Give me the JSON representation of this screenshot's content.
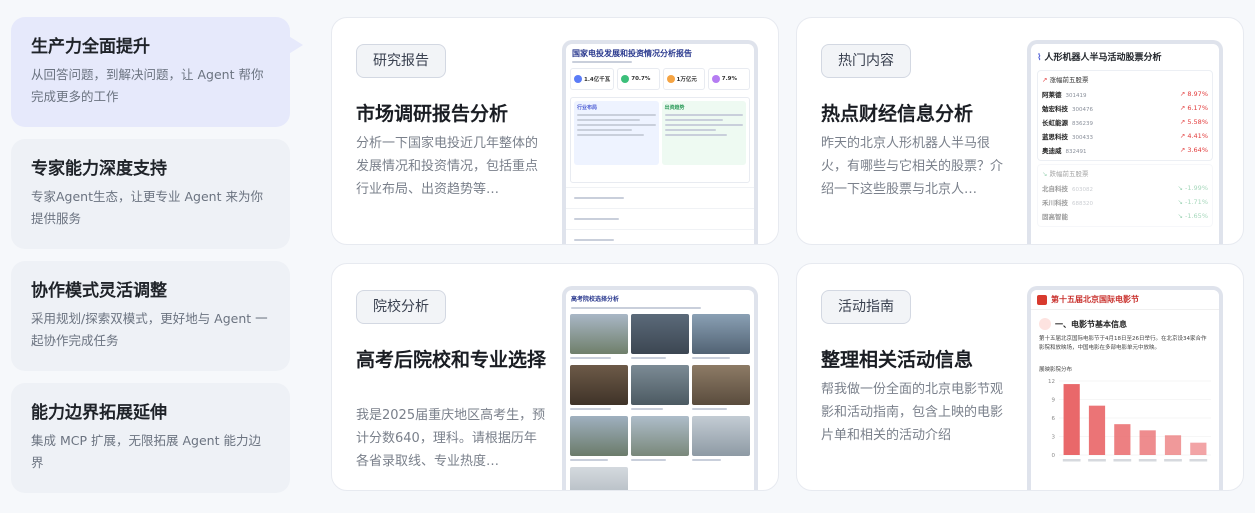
{
  "features": [
    {
      "title": "生产力全面提升",
      "desc": "从回答问题，到解决问题，让 Agent 帮你完成更多的工作"
    },
    {
      "title": "专家能力深度支持",
      "desc": "专家Agent生态，让更专业 Agent 来为你提供服务"
    },
    {
      "title": "协作模式灵活调整",
      "desc": "采用规划/探索双模式，更好地与 Agent 一起协作完成任务"
    },
    {
      "title": "能力边界拓展延伸",
      "desc": "集成 MCP 扩展，无限拓展 Agent 能力边界"
    }
  ],
  "cards": [
    {
      "tag": "研究报告",
      "title": "市场调研报告分析",
      "desc": "分析一下国家电投近几年整体的发展情况和投资情况，包括重点行业布局、出资趋势等…"
    },
    {
      "tag": "热门内容",
      "title": "热点财经信息分析",
      "desc": "昨天的北京人形机器人半马很火，有哪些与它相关的股票？介绍一下这些股票与北京人…"
    },
    {
      "tag": "院校分析",
      "title": "高考后院校和专业选择",
      "desc": "我是2025届重庆地区高考生，预计分数640，理科。请根据历年各省录取线、专业热度…"
    },
    {
      "tag": "活动指南",
      "title": "整理相关活动信息",
      "desc": "帮我做一份全面的北京电影节观影和活动指南，包含上映的电影片单和相关的活动介绍"
    }
  ],
  "preview_report": {
    "title": "国家电投发展和投资情况分析报告",
    "kpis": [
      {
        "value": "1.4亿千瓦",
        "color": "#5b7cf7"
      },
      {
        "value": "70.7%",
        "color": "#3cbf7a"
      },
      {
        "value": "1万亿元",
        "color": "#f5a443"
      },
      {
        "value": "7.9%",
        "color": "#b57cf2"
      }
    ],
    "panel_left": "行业布局",
    "panel_right": "出资趋势"
  },
  "preview_stocks": {
    "title": "人形机器人半马活动股票分析",
    "up_group": "涨幅前五股票",
    "up": [
      {
        "name": "阿莱德",
        "code": "301419",
        "chg": "↗ 8.97%"
      },
      {
        "name": "勉宏科技",
        "code": "300476",
        "chg": "↗ 6.17%"
      },
      {
        "name": "长虹能源",
        "code": "836239",
        "chg": "↗ 5.58%"
      },
      {
        "name": "蓝思科技",
        "code": "300433",
        "chg": "↗ 4.41%"
      },
      {
        "name": "奥迪威",
        "code": "832491",
        "chg": "↗ 3.64%"
      }
    ],
    "down_group": "跌幅前五股票",
    "down": [
      {
        "name": "北自科技",
        "code": "603082",
        "chg": "↘ -1.99%"
      },
      {
        "name": "禾川科技",
        "code": "688320",
        "chg": "↘ -1.71%"
      },
      {
        "name": "固高智能",
        "code": "",
        "chg": "↘ -1.65%"
      }
    ]
  },
  "preview_schools": {
    "title": "高考院校选择分析"
  },
  "preview_festival": {
    "title": "第十五届北京国际电影节",
    "section": "一、电影节基本信息",
    "body": "第十五届北京国际电影节于4月18日至26日举行。在北京设34家合作影院和放映场，中国电影在多部电影单元中放映。",
    "chart_label": "展映影院分布",
    "y_ticks": [
      "12",
      "9",
      "6",
      "3",
      "0"
    ],
    "values": [
      11.5,
      8.0,
      5.0,
      4.0,
      3.2,
      2.0
    ],
    "accent": "#e9686a"
  }
}
